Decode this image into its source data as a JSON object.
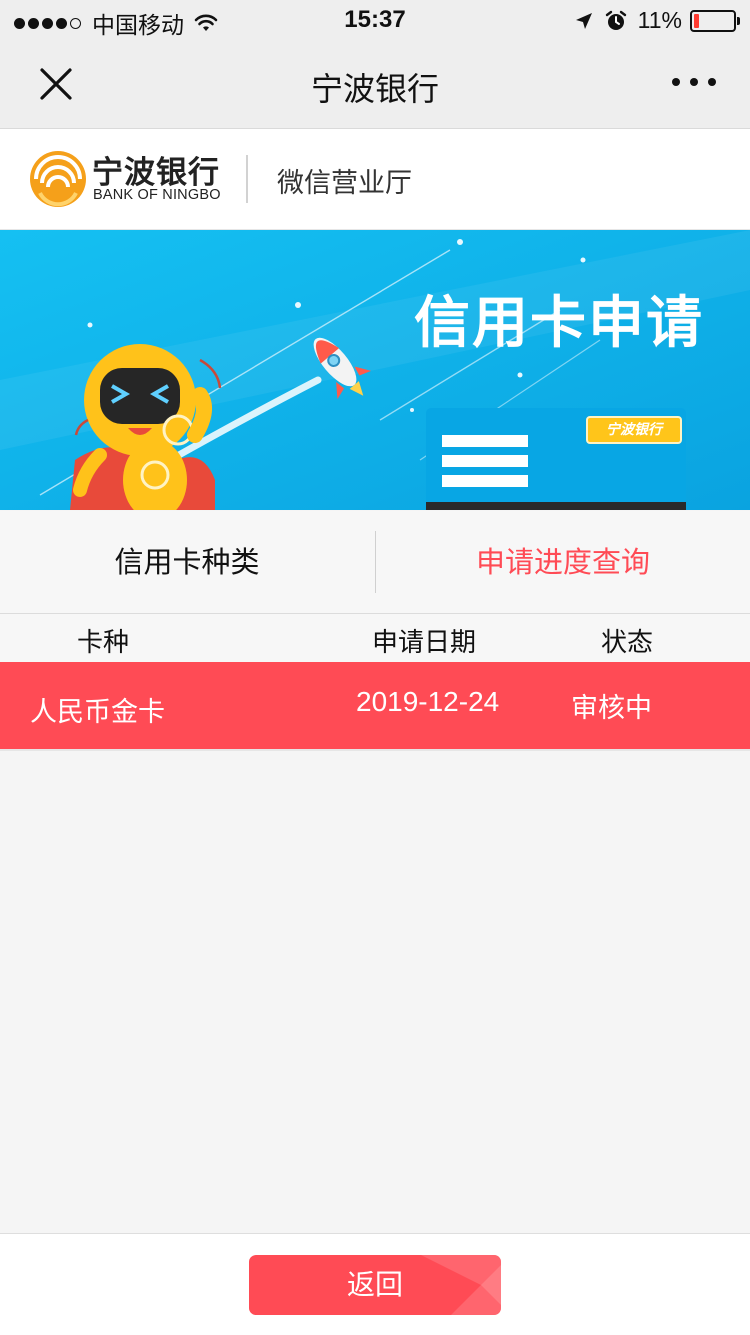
{
  "status_bar": {
    "carrier": "中国移动",
    "time": "15:37",
    "battery": "11%"
  },
  "nav": {
    "title": "宁波银行",
    "close_icon": "close-icon",
    "more_icon": "more-icon"
  },
  "brand": {
    "name": "宁波银行",
    "name_en": "BANK OF NINGBO",
    "hall": "微信营业厅"
  },
  "banner": {
    "title": "信用卡申请",
    "card_brand": "宁波银行"
  },
  "tabs": [
    {
      "label": "信用卡种类",
      "active": false
    },
    {
      "label": "申请进度查询",
      "active": true
    }
  ],
  "table": {
    "columns": [
      "卡种",
      "申请日期",
      "状态"
    ],
    "rows": [
      {
        "type": "人民币金卡",
        "date": "2019-12-24",
        "status": "审核中"
      }
    ]
  },
  "footer": {
    "back_label": "返回"
  },
  "colors": {
    "accent": "#ff4b55",
    "banner_bg": "#10b0ea",
    "brand_orange": "#f5a01a"
  }
}
